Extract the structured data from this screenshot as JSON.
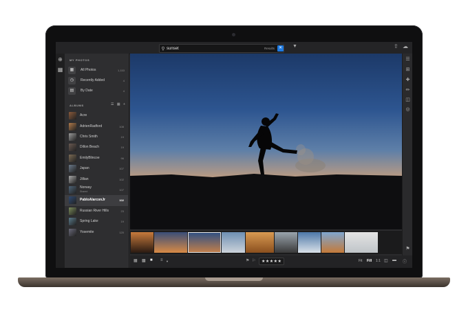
{
  "search": {
    "value": "sunset",
    "results_label": "Results",
    "clear_icon": "close-icon"
  },
  "sidebar": {
    "my_photos_header": "MY PHOTOS",
    "nav": [
      {
        "label": "All Photos",
        "count": "1,153",
        "icon": "photos-icon"
      },
      {
        "label": "Recently Added",
        "count": "4",
        "icon": "clock-icon"
      },
      {
        "label": "By Date",
        "count": "4",
        "icon": "calendar-icon"
      }
    ],
    "albums_header": "ALBUMS",
    "albums": [
      {
        "name": "Acre",
        "count": "",
        "sub": "",
        "color": "#8a5a3a"
      },
      {
        "name": "AdrienRadford",
        "count": "108",
        "sub": "",
        "color": "#b07a4a"
      },
      {
        "name": "Chris Smith",
        "count": "19",
        "sub": "",
        "color": "#9a9a9a"
      },
      {
        "name": "Dillon Beach",
        "count": "19",
        "sub": "",
        "color": "#6a5a52"
      },
      {
        "name": "EmilyBlincoe",
        "count": "96",
        "sub": "",
        "color": "#7c6b55"
      },
      {
        "name": "Japan",
        "count": "107",
        "sub": "",
        "color": "#6b7a8a"
      },
      {
        "name": "Jillian",
        "count": "102",
        "sub": "",
        "color": "#a8a8a8"
      },
      {
        "name": "Norway",
        "count": "107",
        "sub": "Shared",
        "color": "#4e6478"
      },
      {
        "name": "PabloAlarconJr",
        "count": "102",
        "sub": "",
        "color": "#2f4a72",
        "selected": true
      },
      {
        "name": "Russian River Hills",
        "count": "23",
        "sub": "",
        "color": "#7a8a5a"
      },
      {
        "name": "Spring Lake",
        "count": "19",
        "sub": "",
        "color": "#5a7a8a"
      },
      {
        "name": "Yosemite",
        "count": "120",
        "sub": "",
        "color": "#6a6a7a"
      }
    ]
  },
  "filmstrip": [
    {
      "label": "thumb-1",
      "c1": "#c77a3c",
      "c2": "#2a1a12"
    },
    {
      "label": "thumb-2",
      "c1": "#3a4e78",
      "c2": "#d88a45"
    },
    {
      "label": "thumb-3",
      "c1": "#2d4f84",
      "c2": "#c5804a",
      "selected": true
    },
    {
      "label": "thumb-4",
      "c1": "#6e8fb2",
      "c2": "#ccd3da"
    },
    {
      "label": "thumb-5",
      "c1": "#d99a52",
      "c2": "#8a4f1e"
    },
    {
      "label": "thumb-6",
      "c1": "#9aa4ad",
      "c2": "#3a3a3a"
    },
    {
      "label": "thumb-7",
      "c1": "#4d78a8",
      "c2": "#d9e1e8"
    },
    {
      "label": "thumb-8",
      "c1": "#7fa6cf",
      "c2": "#c47a3a"
    },
    {
      "label": "thumb-9",
      "c1": "#e4e4e4",
      "c2": "#bfc4c8"
    }
  ],
  "bottombar": {
    "rating": "★★★★★",
    "zoom_fit": "Fit",
    "zoom_fill": "Fill",
    "zoom_1to1": "1:1"
  }
}
